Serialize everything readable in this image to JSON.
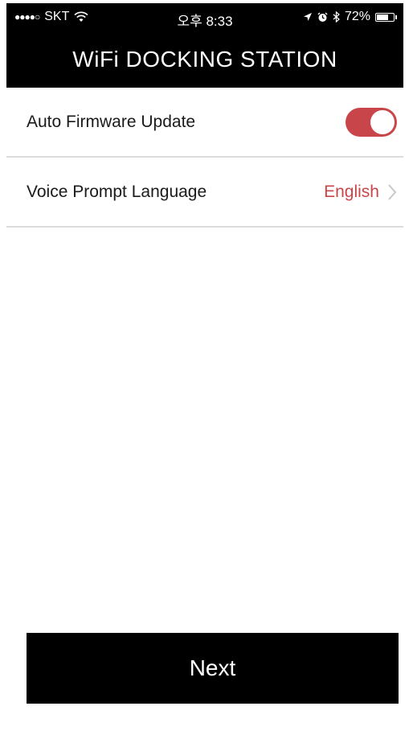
{
  "status_bar": {
    "signal": "●●●●○",
    "carrier": "SKT",
    "time": "오후 8:33",
    "battery_percent": "72%",
    "battery_level": 0.72,
    "icons": [
      "wifi-icon",
      "location-arrow-icon",
      "alarm-icon",
      "bluetooth-icon",
      "battery-icon"
    ]
  },
  "header": {
    "title": "WiFi DOCKING STATION"
  },
  "settings": {
    "items": [
      {
        "label": "Auto Firmware Update",
        "control": "toggle",
        "state": "on"
      },
      {
        "label": "Voice Prompt Language",
        "control": "disclosure",
        "value": "English"
      }
    ]
  },
  "footer": {
    "next_label": "Next"
  },
  "colors": {
    "accent": "#c8464a",
    "header_bg": "#000000",
    "button_bg": "#000000",
    "divider": "#dcdcdc",
    "chevron": "#c7c7cc"
  }
}
